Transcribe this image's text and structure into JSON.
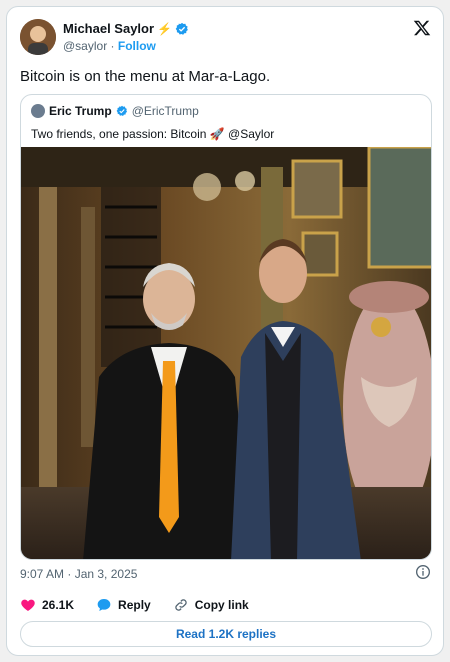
{
  "author": {
    "name": "Michael Saylor",
    "name_emoji": "⚡",
    "handle": "@saylor",
    "separator": "·",
    "follow_label": "Follow"
  },
  "tweet": {
    "text": "Bitcoin is on the menu at Mar-a-Lago.",
    "timestamp": "9:07 AM · Jan 3, 2025"
  },
  "quote": {
    "name": "Eric Trump",
    "handle": "@EricTrump",
    "text": "Two friends, one passion: Bitcoin 🚀  @Saylor"
  },
  "actions": {
    "likes": "26.1K",
    "reply_label": "Reply",
    "copy_label": "Copy link"
  },
  "replies_button": "Read 1.2K replies",
  "colors": {
    "accent": "#1d9bf0",
    "verified": "#1d9bf0",
    "like": "#f91880",
    "bolt": "#f7a600"
  },
  "icons": [
    "x-logo-icon",
    "verified-icon",
    "info-icon",
    "heart-icon",
    "reply-icon",
    "link-icon"
  ]
}
